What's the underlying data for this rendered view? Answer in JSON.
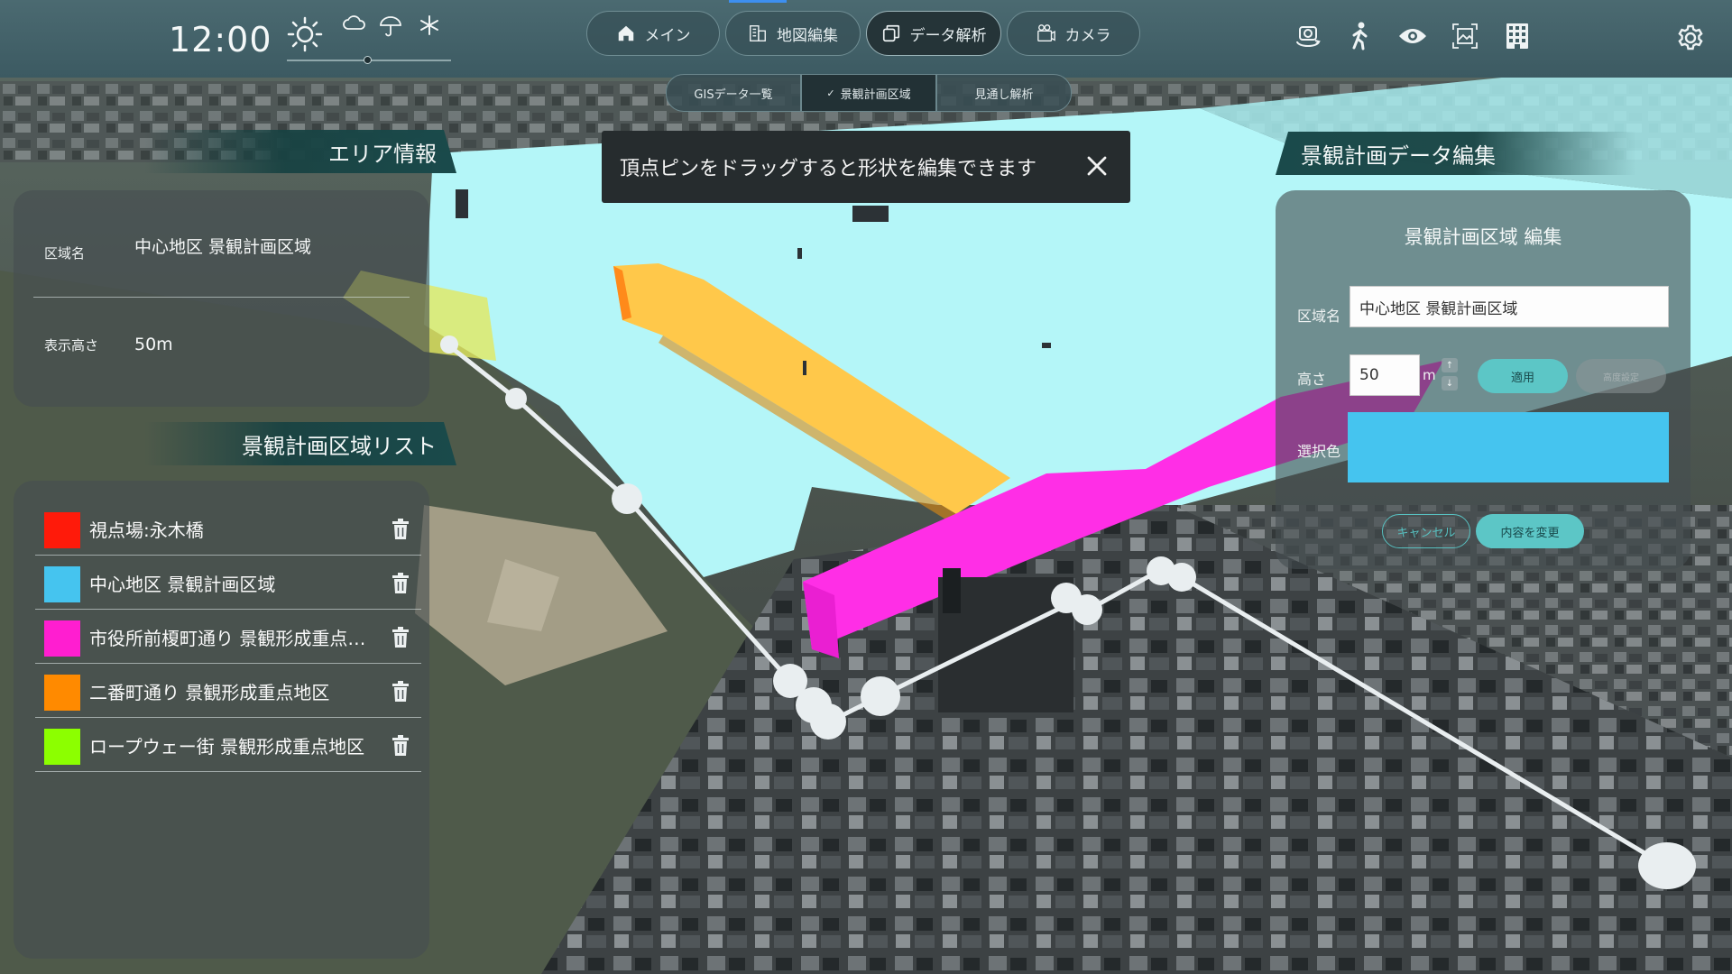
{
  "header": {
    "time": "12:00",
    "weather": {
      "icons": [
        "sun-icon",
        "cloud-icon",
        "umbrella-icon",
        "snowflake-icon"
      ],
      "slider_value": 0.47
    },
    "nav_tabs": [
      {
        "label": "メイン",
        "icon": "home-icon"
      },
      {
        "label": "地図編集",
        "icon": "building-icon"
      },
      {
        "label": "データ解析",
        "icon": "layers-icon",
        "active": true
      },
      {
        "label": "カメラ",
        "icon": "camera-icon"
      }
    ],
    "tool_icons": [
      "camera-rotate-icon",
      "walk-icon",
      "eye-icon",
      "frame-icon",
      "building-grid-icon"
    ],
    "settings_icon": "gear-icon"
  },
  "sub_tabs": [
    {
      "label": "GISデータ一覧"
    },
    {
      "label": "景観計画区域",
      "active": true,
      "check": "✓"
    },
    {
      "label": "見通し解析"
    }
  ],
  "toast": {
    "message": "頂点ピンをドラッグすると形状を編集できます"
  },
  "area_info": {
    "header": "エリア情報",
    "name_label": "区域名",
    "name_value": "中心地区 景観計画区域",
    "height_label": "表示高さ",
    "height_value": "50m"
  },
  "area_list": {
    "header": "景観計画区域リスト",
    "items": [
      {
        "label": "視点場:永木橋",
        "color": "#ff1a0a"
      },
      {
        "label": "中心地区 景観計画区域",
        "color": "#45c4ef"
      },
      {
        "label": "市役所前榎町通り 景観形成重点地区",
        "color": "#ff1ed0"
      },
      {
        "label": "二番町通り 景観形成重点地区",
        "color": "#ff8a00"
      },
      {
        "label": "ロープウェー街 景観形成重点地区",
        "color": "#8cff00"
      }
    ]
  },
  "edit": {
    "header": "景観計画データ編集",
    "title": "景観計画区域 編集",
    "name_label": "区域名",
    "name_value": "中心地区 景観計画区域",
    "height_label": "高さ",
    "height_value": "50",
    "unit": "m",
    "apply_label": "適用",
    "disabled_label": "高度設定",
    "color_label": "選択色",
    "color_value": "#45c4ef",
    "cancel_label": "キャンセル",
    "save_label": "内容を変更",
    "step_up": "↑",
    "step_down": "↓"
  },
  "colors": {
    "topbar": "#44636a",
    "accent": "#5cc6c6",
    "water_overlay": "#b4f6f8",
    "yellow_zone": "#ffc84a",
    "magenta_zone": "#ff30e8"
  }
}
